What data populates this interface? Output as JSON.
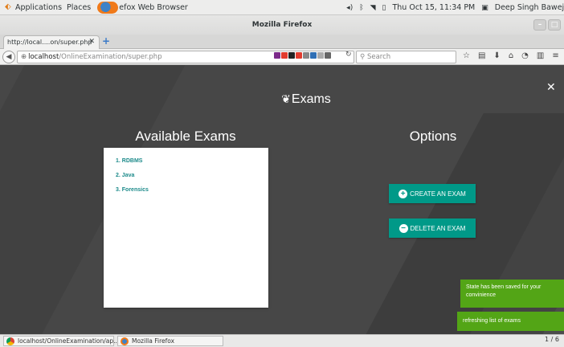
{
  "topbar": {
    "applications": "Applications",
    "places": "Places",
    "browser_label": "efox Web Browser",
    "datetime": "Thu Oct 15, 11:34 PM",
    "user": "Deep Singh Baweja"
  },
  "window": {
    "title": "Mozilla Firefox"
  },
  "tab": {
    "label": "http://local....on/super.php"
  },
  "nav": {
    "url_host": "localhost",
    "url_path": "/OnlineExamination/super.php",
    "search_placeholder": "Search"
  },
  "page": {
    "title": "Exams",
    "available_heading": "Available Exams",
    "options_heading": "Options",
    "exams": [
      "1. RDBMS",
      "2. Java",
      "3. Forensics"
    ],
    "create_button": "CREATE AN EXAM",
    "delete_button": "DELETE AN EXAM",
    "toasts": [
      "State has been saved for your convinience",
      "refreshing list of exams"
    ]
  },
  "taskbar": {
    "task1": "localhost/OnlineExamination/ap...",
    "task2": "Mozilla Firefox",
    "pager": "1 / 6"
  },
  "colors": {
    "accent": "#009988",
    "toast": "#53a516",
    "page_bg": "#474747",
    "exam_link": "#1c8a8a"
  },
  "icons": [
    "apps-icon",
    "firefox-icon",
    "volume-icon",
    "bluetooth-icon",
    "wifi-icon",
    "battery-icon",
    "user-icon",
    "close-icon",
    "back-icon",
    "globe-icon",
    "reload-icon",
    "search-icon",
    "bookmark-star-icon",
    "reading-list-icon",
    "download-icon",
    "home-icon",
    "menu-icon",
    "leaf-icon",
    "plus-circle-icon",
    "minus-circle-icon",
    "chrome-icon"
  ]
}
